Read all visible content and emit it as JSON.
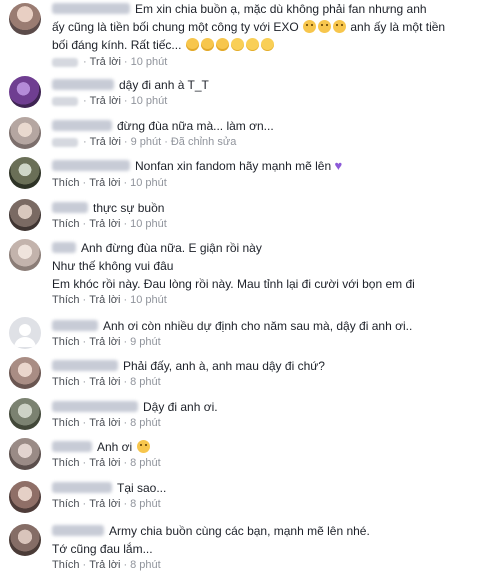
{
  "colors": {
    "link": "#4b4f56",
    "meta": "#90949c",
    "text": "#1d2129",
    "heart": "#8c5ad8",
    "emoji": "#f7c64d"
  },
  "comments": [
    {
      "lines": [
        "Em xin chia buồn ạ, mặc dù không phải fan nhưng anh",
        "ấy cũng là tiền bối chung một công ty với EXO",
        "anh ấy là một tiền",
        "bối đáng kính. Rất tiếc..."
      ],
      "reply": "Trả lời",
      "time": "10 phút"
    },
    {
      "lines": [
        "dậy đi anh à T_T"
      ],
      "like": "Thích",
      "reply": "Trả lời",
      "time": "10 phút"
    },
    {
      "lines": [
        "đừng đùa nữa mà... làm ơn..."
      ],
      "like": "Thích",
      "reply": "Trả lời",
      "time": "9 phút",
      "edited": "Đã chỉnh sửa"
    },
    {
      "lines": [
        "Nonfan xin fandom hãy mạnh mẽ lên"
      ],
      "like": "Thích",
      "reply": "Trả lời",
      "time": "10 phút",
      "heart_icon": "purple-heart"
    },
    {
      "lines": [
        "thực sự buồn"
      ],
      "like": "Thích",
      "reply": "Trả lời",
      "time": "10 phút"
    },
    {
      "lines": [
        "Anh đừng đùa nữa. E giận rồi này",
        "Như thế không vui đâu",
        "Em khóc rồi này. Đau lòng rồi này. Mau tỉnh lại đi cười với bọn em đi"
      ],
      "like": "Thích",
      "reply": "Trả lời",
      "time": "10 phút"
    },
    {
      "lines": [
        "Anh ơi còn nhiều dự định cho năm sau mà, dậy đi anh ơi.."
      ],
      "like": "Thích",
      "reply": "Trả lời",
      "time": "9 phút"
    },
    {
      "lines": [
        "Phải đấy, anh à, anh mau dậy đi chứ?"
      ],
      "like": "Thích",
      "reply": "Trả lời",
      "time": "8 phút"
    },
    {
      "lines": [
        "Dậy đi anh ơi."
      ],
      "like": "Thích",
      "reply": "Trả lời",
      "time": "8 phút"
    },
    {
      "lines": [
        "Anh ơi"
      ],
      "like": "Thích",
      "reply": "Trả lời",
      "time": "8 phút",
      "emoji_icon": "disappointed-face"
    },
    {
      "lines": [
        "Tại sao..."
      ],
      "like": "Thích",
      "reply": "Trả lời",
      "time": "8 phút"
    },
    {
      "lines": [
        "Army chia buồn cùng các bạn, mạnh mẽ lên nhé.",
        "Tớ cũng đau lắm..."
      ],
      "like": "Thích",
      "reply": "Trả lời",
      "time": "8 phút"
    }
  ]
}
